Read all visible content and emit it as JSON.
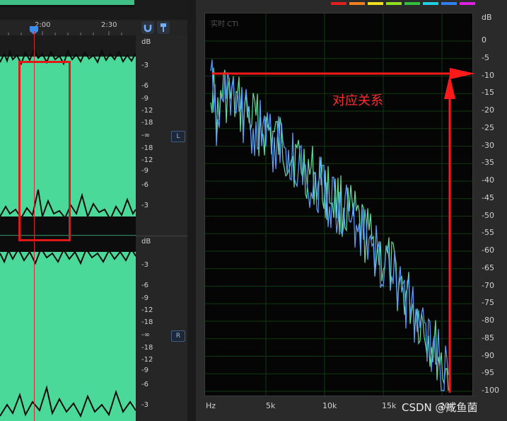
{
  "timeline": {
    "ticks": [
      "2:00",
      "2:30"
    ]
  },
  "waveform": {
    "db_label": "dB",
    "db_ticks": [
      "-3",
      "-6",
      "-9",
      "-12",
      "-18",
      "-∞",
      "-18",
      "-12",
      "-9",
      "-6",
      "-3"
    ],
    "channel_left": "L",
    "channel_right": "R"
  },
  "spectrum": {
    "realtime_label": "实时 CTI",
    "db_unit": "dB",
    "db_ticks": [
      "0",
      "-5",
      "-10",
      "-15",
      "-20",
      "-25",
      "-30",
      "-35",
      "-40",
      "-45",
      "-50",
      "-55",
      "-60",
      "-65",
      "-70",
      "-75",
      "-80",
      "-85",
      "-90",
      "-95",
      "-100"
    ],
    "x_ticks": [
      "Hz",
      "5k",
      "10k",
      "15k",
      "20k"
    ],
    "annotation": "对应关系"
  },
  "colors": {
    "waveform": "#4bd99a",
    "series_green": "#5ee0a0",
    "series_blue": "#5aa0ff",
    "annotation": "#ff1a1a",
    "swatches": [
      "#e02020",
      "#f08020",
      "#f0e020",
      "#90e020",
      "#30c040",
      "#20d0e0",
      "#3080f0",
      "#e020e0"
    ]
  },
  "watermark": "CSDN @咸鱼菌"
}
